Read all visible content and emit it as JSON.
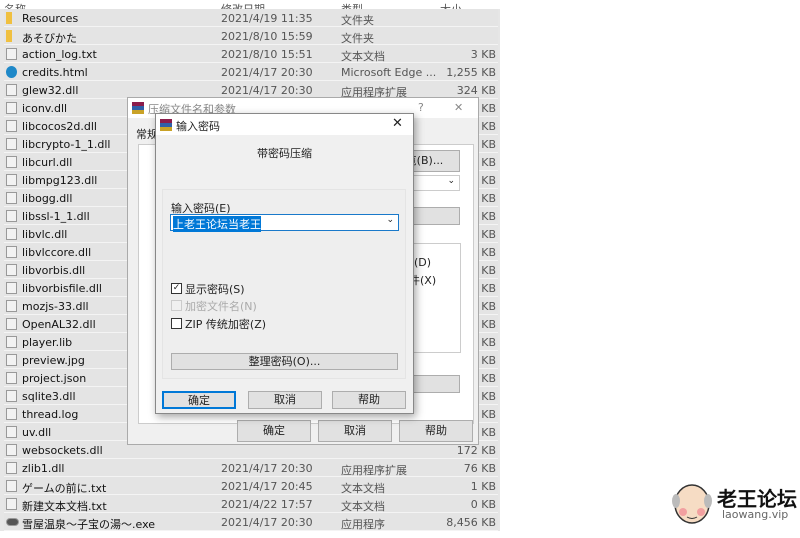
{
  "header": {
    "name": "名称",
    "date": "修改日期",
    "type": "类型",
    "size": "大小"
  },
  "files": [
    {
      "name": "Resources",
      "date": "2021/4/19 11:35",
      "type": "文件夹",
      "size": "",
      "icon": "folder-icon"
    },
    {
      "name": "あそびかた",
      "date": "2021/8/10 15:59",
      "type": "文件夹",
      "size": "",
      "icon": "folder-icon"
    },
    {
      "name": "action_log.txt",
      "date": "2021/8/10 15:51",
      "type": "文本文档",
      "size": "3 KB",
      "icon": "text-file-icon"
    },
    {
      "name": "credits.html",
      "date": "2021/4/17 20:30",
      "type": "Microsoft Edge ...",
      "size": "1,255 KB",
      "icon": "edge-icon"
    },
    {
      "name": "glew32.dll",
      "date": "2021/4/17 20:30",
      "type": "应用程序扩展",
      "size": "324 KB",
      "icon": "dll-icon"
    },
    {
      "name": "iconv.dll",
      "date": "",
      "type": "",
      "size": "KB",
      "icon": "dll-icon"
    },
    {
      "name": "libcocos2d.dll",
      "date": "",
      "type": "",
      "size": "KB",
      "icon": "dll-icon"
    },
    {
      "name": "libcrypto-1_1.dll",
      "date": "",
      "type": "",
      "size": "KB",
      "icon": "dll-icon"
    },
    {
      "name": "libcurl.dll",
      "date": "",
      "type": "",
      "size": "KB",
      "icon": "dll-icon"
    },
    {
      "name": "libmpg123.dll",
      "date": "",
      "type": "",
      "size": "KB",
      "icon": "dll-icon"
    },
    {
      "name": "libogg.dll",
      "date": "",
      "type": "",
      "size": "KB",
      "icon": "dll-icon"
    },
    {
      "name": "libssl-1_1.dll",
      "date": "",
      "type": "",
      "size": "KB",
      "icon": "dll-icon"
    },
    {
      "name": "libvlc.dll",
      "date": "",
      "type": "",
      "size": "KB",
      "icon": "dll-icon"
    },
    {
      "name": "libvlccore.dll",
      "date": "",
      "type": "",
      "size": "KB",
      "icon": "dll-icon"
    },
    {
      "name": "libvorbis.dll",
      "date": "",
      "type": "",
      "size": "KB",
      "icon": "dll-icon"
    },
    {
      "name": "libvorbisfile.dll",
      "date": "",
      "type": "",
      "size": "KB",
      "icon": "dll-icon"
    },
    {
      "name": "mozjs-33.dll",
      "date": "",
      "type": "",
      "size": "KB",
      "icon": "dll-icon"
    },
    {
      "name": "OpenAL32.dll",
      "date": "",
      "type": "",
      "size": "KB",
      "icon": "dll-icon"
    },
    {
      "name": "player.lib",
      "date": "",
      "type": "",
      "size": "KB",
      "icon": "file-icon"
    },
    {
      "name": "preview.jpg",
      "date": "",
      "type": "",
      "size": "KB",
      "icon": "image-icon"
    },
    {
      "name": "project.json",
      "date": "",
      "type": "",
      "size": "KB",
      "icon": "file-icon"
    },
    {
      "name": "sqlite3.dll",
      "date": "",
      "type": "",
      "size": "KB",
      "icon": "dll-icon"
    },
    {
      "name": "thread.log",
      "date": "",
      "type": "",
      "size": "KB",
      "icon": "file-icon"
    },
    {
      "name": "uv.dll",
      "date": "",
      "type": "",
      "size": "KB",
      "icon": "dll-icon"
    },
    {
      "name": "websockets.dll",
      "date": "",
      "type": "",
      "size": "172 KB",
      "icon": "dll-icon"
    },
    {
      "name": "zlib1.dll",
      "date": "2021/4/17 20:30",
      "type": "应用程序扩展",
      "size": "76 KB",
      "icon": "dll-icon"
    },
    {
      "name": "ゲームの前に.txt",
      "date": "2021/4/17 20:45",
      "type": "文本文档",
      "size": "1 KB",
      "icon": "text-file-icon"
    },
    {
      "name": "新建文本文档.txt",
      "date": "2021/4/22 17:57",
      "type": "文本文档",
      "size": "0 KB",
      "icon": "text-file-icon"
    },
    {
      "name": "雪屋温泉～子宝の湯～.exe",
      "date": "2021/4/17 20:30",
      "type": "应用程序",
      "size": "8,456 KB",
      "icon": "gamepad-icon"
    }
  ],
  "bg_dialog": {
    "title": "压缩文件名和参数",
    "help": "?",
    "close": "✕",
    "tab": "常规",
    "browse": "浏览(B)...",
    "opt_d": "(D)",
    "opt_x": "件(X)",
    "ok": "确定",
    "cancel": "取消",
    "help_btn": "帮助"
  },
  "dialog": {
    "title": "输入密码",
    "close": "✕",
    "heading": "带密码压缩",
    "label": "输入密码(E)",
    "password": "上老王论坛当老王",
    "show_pw": "显示密码(S)",
    "show_pw_checked": true,
    "encrypt_names": "加密文件名(N)",
    "encrypt_names_checked": false,
    "zip_legacy": "ZIP 传统加密(Z)",
    "zip_legacy_checked": false,
    "organize": "整理密码(O)...",
    "ok": "确定",
    "cancel": "取消",
    "help": "帮助"
  },
  "watermark": {
    "name": "老王论坛",
    "url": "laowang.vip"
  }
}
